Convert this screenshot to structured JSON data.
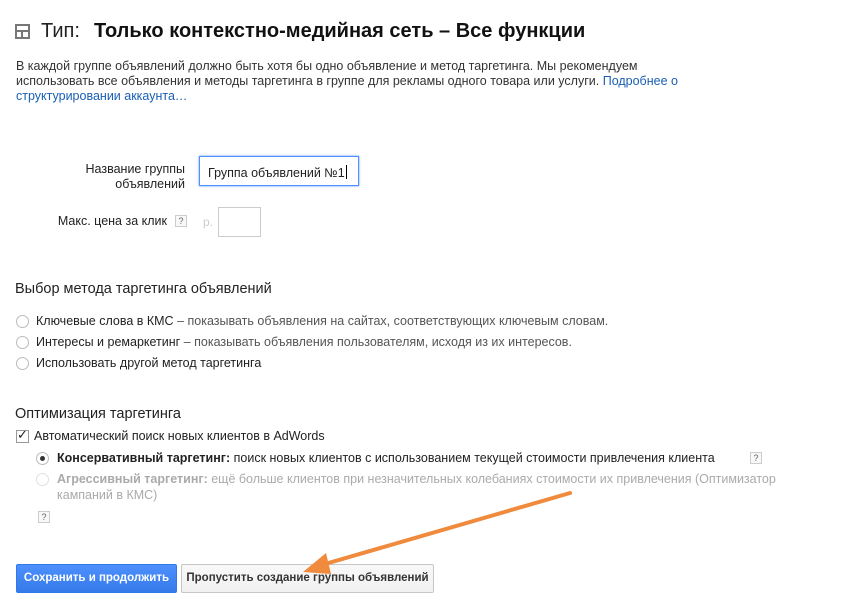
{
  "header": {
    "title_prefix": "Тип:",
    "title_main": "Только контекстно-медийная сеть – Все функции",
    "icon": "layout-grid-icon"
  },
  "intro": {
    "text": "В каждой группе объявлений должно быть хотя бы одно объявление и метод таргетинга. Мы рекомендуем использовать все объявления и методы таргетинга в группе для рекламы одного товара или услуги.",
    "link_text": "Подробнее о структурировании аккаунта…"
  },
  "form": {
    "ad_group_label": "Название группы объявлений",
    "ad_group_value": "Группа объявлений №1",
    "max_cpc_label": "Макс. цена за клик",
    "help_glyph": "?",
    "currency_symbol": "р.",
    "max_cpc_value": ""
  },
  "targeting": {
    "title": "Выбор метода таргетинга объявлений",
    "options": [
      {
        "label": "Ключевые слова в КМС",
        "desc": " – показывать объявления на сайтах, соответствующих ключевым словам.",
        "selected": false
      },
      {
        "label": "Интересы и ремаркетинг",
        "desc": " – показывать объявления пользователям, исходя из их интересов.",
        "selected": false
      },
      {
        "label": "Использовать другой метод таргетинга",
        "desc": "",
        "selected": false
      }
    ]
  },
  "optimization": {
    "title": "Оптимизация таргетинга",
    "auto_label": "Автоматический поиск новых клиентов в AdWords",
    "auto_checked": true,
    "conservative_strong": "Консервативный таргетинг:",
    "conservative_desc": " поиск новых клиентов с использованием текущей стоимости привлечения клиента",
    "aggressive_strong": "Агрессивный таргетинг:",
    "aggressive_desc_line1": " ещё больше клиентов при незначительных колебаниях стоимости их привлечения (Оптимизатор",
    "aggressive_desc_line2": "кампаний в КМС)"
  },
  "buttons": {
    "save_label": "Сохранить и продолжить",
    "skip_label": "Пропустить создание группы объявлений"
  },
  "colors": {
    "primary": "#4d90fe",
    "link": "#1a5fb4",
    "arrow": "#f08a3c"
  }
}
